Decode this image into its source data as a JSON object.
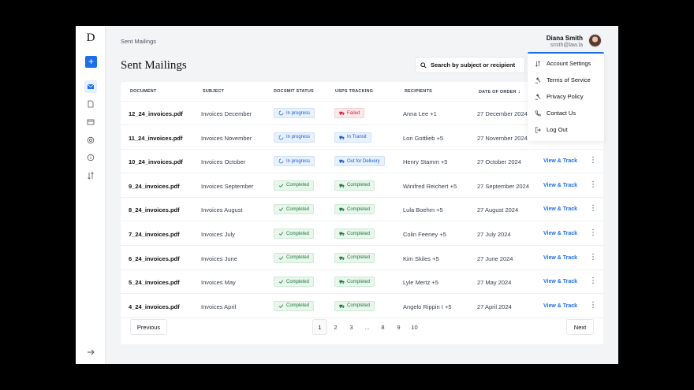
{
  "app": {
    "logo": "D",
    "add_label": "+"
  },
  "breadcrumb": "Sent Mailings",
  "user": {
    "name": "Diana Smith",
    "email": "smith@law.la"
  },
  "page_title": "Sent Mailings",
  "search": {
    "placeholder": "Search by subject or recipient"
  },
  "columns": [
    "DOCUMENT",
    "SUBJECT",
    "DOCSMIT STATUS",
    "USPS TRACKING",
    "RECIPIENTS",
    "DATE OF ORDER"
  ],
  "rows": [
    {
      "document": "12_24_invoices.pdf",
      "subject": "Invoices December",
      "status": "In progress",
      "tracking": "Failed",
      "recipients": "Anna Lee +1",
      "date": "27 December 2024",
      "action": ""
    },
    {
      "document": "11_24_invoices.pdf",
      "subject": "Invoices November",
      "status": "In progress",
      "tracking": "In Transit",
      "recipients": "Lori Gottlieb +5",
      "date": "27 November 2024",
      "action": ""
    },
    {
      "document": "10_24_invoices.pdf",
      "subject": "Invoices October",
      "status": "In progress",
      "tracking": "Out for Delivery",
      "recipients": "Henry Stamm +5",
      "date": "27 October 2024",
      "action": "View & Track"
    },
    {
      "document": "9_24_invoices.pdf",
      "subject": "Invoices September",
      "status": "Completed",
      "tracking": "Completed",
      "recipients": "Winifred Reichert +5",
      "date": "27 September 2024",
      "action": "View & Track"
    },
    {
      "document": "8_24_invoices.pdf",
      "subject": "Invoices August",
      "status": "Completed",
      "tracking": "Completed",
      "recipients": "Lula Boehm +5",
      "date": "27 August 2024",
      "action": "View & Track"
    },
    {
      "document": "7_24_invoices.pdf",
      "subject": "Invoices July",
      "status": "Completed",
      "tracking": "Completed",
      "recipients": "Colin Feeney +5",
      "date": "27 July 2024",
      "action": "View & Track"
    },
    {
      "document": "6_24_invoices.pdf",
      "subject": "Invoices June",
      "status": "Completed",
      "tracking": "Completed",
      "recipients": "Kim Skiles +5",
      "date": "27 June 2024",
      "action": "View & Track"
    },
    {
      "document": "5_24_invoices.pdf",
      "subject": "Invoices May",
      "status": "Completed",
      "tracking": "Completed",
      "recipients": "Lyle Mertz +5",
      "date": "27 May 2024",
      "action": "View & Track"
    },
    {
      "document": "4_24_invoices.pdf",
      "subject": "Invoices April",
      "status": "Completed",
      "tracking": "Completed",
      "recipients": "Angelo Rippin I +5",
      "date": "27 April 2024",
      "action": "View & Track"
    }
  ],
  "pagination": {
    "previous": "Previous",
    "next": "Next",
    "pages": [
      "1",
      "2",
      "3",
      "...",
      "8",
      "9",
      "10"
    ],
    "current": "1"
  },
  "menu": [
    {
      "label": "Account Settings",
      "icon": "sliders-icon"
    },
    {
      "label": "Terms of Service",
      "icon": "gavel-icon"
    },
    {
      "label": "Privacy Policy",
      "icon": "gavel-icon"
    },
    {
      "label": "Contact Us",
      "icon": "phone-icon"
    },
    {
      "label": "Log Out",
      "icon": "logout-icon"
    }
  ],
  "colors": {
    "accent": "#1d6fe8",
    "progress": "#1d5fc9",
    "completed": "#1f7a3d",
    "failed": "#c9283b"
  }
}
